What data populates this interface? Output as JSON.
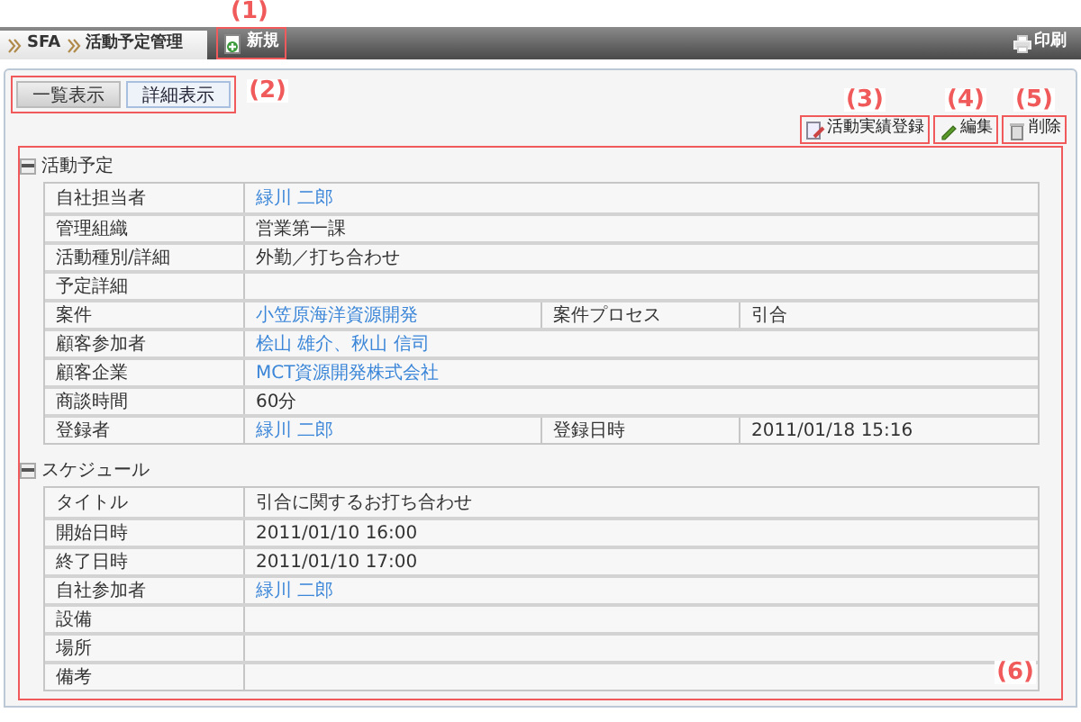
{
  "header": {
    "breadcrumb": [
      "SFA",
      "活動予定管理"
    ],
    "new_button": {
      "label": "新規",
      "callout": "(1)"
    },
    "print_button": {
      "label": "印刷"
    }
  },
  "view_tabs": {
    "callout": "(2)",
    "tabs": [
      {
        "label": "一覧表示",
        "selected": false
      },
      {
        "label": "詳細表示",
        "selected": true
      }
    ]
  },
  "actions": [
    {
      "label": "活動実績登録",
      "kind": "report",
      "callout": "(3)"
    },
    {
      "label": "編集",
      "kind": "edit",
      "callout": "(4)"
    },
    {
      "label": "削除",
      "kind": "delete",
      "callout": "(5)"
    }
  ],
  "details": {
    "callout": "(6)",
    "sections": [
      {
        "title": "活動予定",
        "expanded": true,
        "rows": [
          {
            "label": "自社担当者",
            "value": "緑川 二郎",
            "link": true
          },
          {
            "label": "管理組織",
            "value": "営業第一課",
            "link": false
          },
          {
            "label": "活動種別/詳細",
            "value": "外勤／打ち合わせ",
            "link": false
          },
          {
            "label": "予定詳細",
            "link": false
          },
          {
            "label": "案件",
            "value": "小笠原海洋資源開発",
            "link": true,
            "extra_label": "案件プロセス",
            "extra_value": "引合"
          },
          {
            "label": "顧客参加者",
            "value": "桧山 雄介、秋山 信司",
            "link": true
          },
          {
            "label": "顧客企業",
            "value": "MCT資源開発株式会社",
            "link": true
          },
          {
            "label": "商談時間",
            "value": "60分",
            "link": false
          },
          {
            "label": "登録者",
            "value": "緑川 二郎",
            "link": true,
            "extra_label": "登録日時",
            "extra_value": "2011/01/18 15:16"
          }
        ]
      },
      {
        "title": "スケジュール",
        "expanded": true,
        "rows": [
          {
            "label": "タイトル",
            "value": "引合に関するお打ち合わせ",
            "link": false
          },
          {
            "label": "開始日時",
            "value": "2011/01/10 16:00",
            "link": false
          },
          {
            "label": "終了日時",
            "value": "2011/01/10 17:00",
            "link": false
          },
          {
            "label": "自社参加者",
            "value": "緑川 二郎",
            "link": true
          },
          {
            "label": "設備",
            "link": false
          },
          {
            "label": "場所",
            "link": false
          },
          {
            "label": "備考",
            "link": false
          }
        ]
      }
    ]
  }
}
